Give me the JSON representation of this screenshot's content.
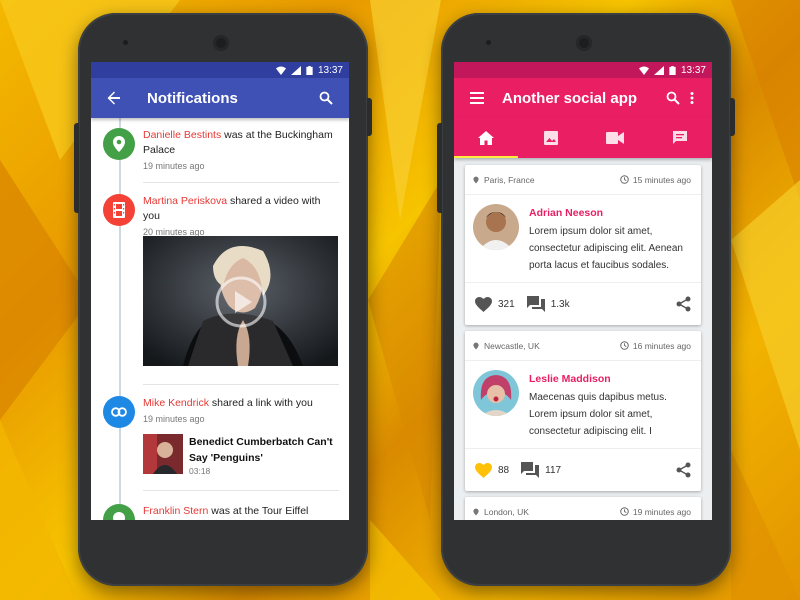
{
  "status": {
    "time": "13:37"
  },
  "left": {
    "title": "Notifications",
    "accent": "#3f51b5",
    "notifications": [
      {
        "name": "Danielle Bestints",
        "text": " was at the Buckingham Palace",
        "time": "19 minutes ago",
        "icon": "location-pin-icon",
        "color": "#43a047"
      },
      {
        "name": "Martina Periskova",
        "text": " shared a video with you",
        "time": "20 minutes ago",
        "icon": "film-icon",
        "color": "#f44336"
      },
      {
        "name": "Mike Kendrick",
        "text": " shared a link with you",
        "time": "19 minutes ago",
        "icon": "link-icon",
        "color": "#1e88e5",
        "link": {
          "title": "Benedict Cumberbatch Can't Say 'Penguins'",
          "duration": "03:18"
        }
      },
      {
        "name": "Franklin Stern",
        "text": " was at the Tour Eiffel",
        "icon": "location-pin-icon",
        "color": "#43a047"
      }
    ]
  },
  "right": {
    "title": "Another social app",
    "accent": "#e91e63",
    "tabs": [
      "home-icon",
      "image-icon",
      "videocam-icon",
      "chat-icon"
    ],
    "posts": [
      {
        "location": "Paris, France",
        "time": "15 minutes ago",
        "author": "Adrian Neeson",
        "text": "Lorem ipsum dolor sit amet, consectetur adipiscing elit. Aenean porta lacus et faucibus sodales.",
        "likes": "321",
        "comments": "1.3k",
        "liked": false
      },
      {
        "location": "Newcastle, UK",
        "time": "16 minutes ago",
        "author": "Leslie Maddison",
        "text": "Maecenas quis dapibus metus. Lorem ipsum dolor sit amet, consectetur adipiscing elit. I",
        "likes": "88",
        "comments": "117",
        "liked": true
      },
      {
        "location": "London, UK",
        "time": "19 minutes ago"
      }
    ]
  }
}
